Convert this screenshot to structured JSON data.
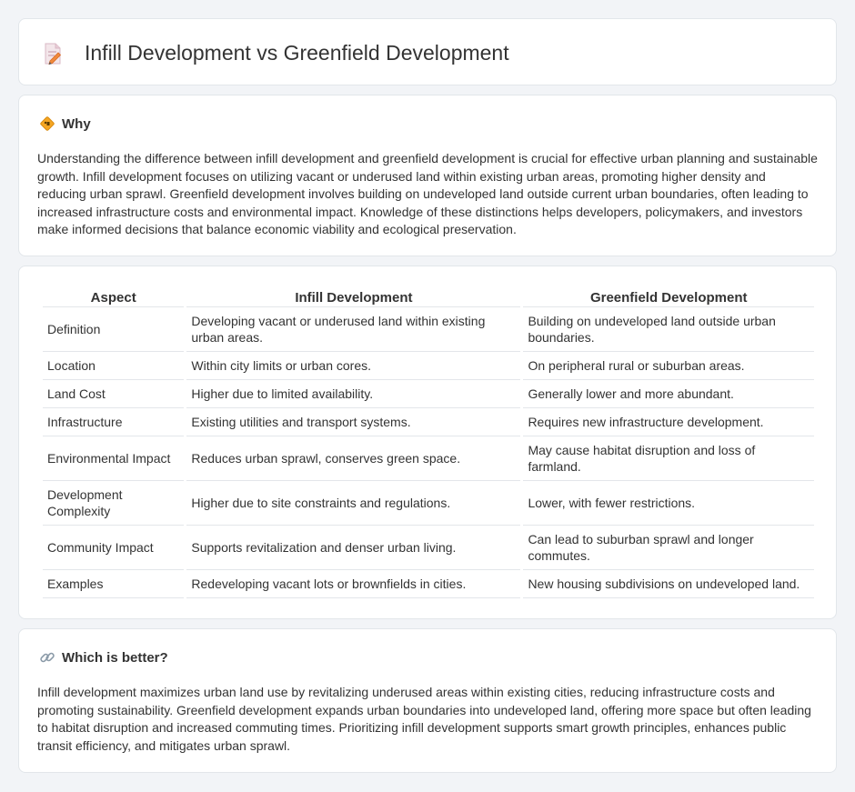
{
  "header": {
    "title": "Infill Development vs Greenfield Development",
    "icon": "document-pencil-icon"
  },
  "why": {
    "title": "Why",
    "icon": "diamond-sign-icon",
    "text": "Understanding the difference between infill development and greenfield development is crucial for effective urban planning and sustainable growth. Infill development focuses on utilizing vacant or underused land within existing urban areas, promoting higher density and reducing urban sprawl. Greenfield development involves building on undeveloped land outside current urban boundaries, often leading to increased infrastructure costs and environmental impact. Knowledge of these distinctions helps developers, policymakers, and investors make informed decisions that balance economic viability and ecological preservation."
  },
  "table": {
    "headers": [
      "Aspect",
      "Infill Development",
      "Greenfield Development"
    ],
    "rows": [
      [
        "Definition",
        "Developing vacant or underused land within existing urban areas.",
        "Building on undeveloped land outside urban boundaries."
      ],
      [
        "Location",
        "Within city limits or urban cores.",
        "On peripheral rural or suburban areas."
      ],
      [
        "Land Cost",
        "Higher due to limited availability.",
        "Generally lower and more abundant."
      ],
      [
        "Infrastructure",
        "Existing utilities and transport systems.",
        "Requires new infrastructure development."
      ],
      [
        "Environmental Impact",
        "Reduces urban sprawl, conserves green space.",
        "May cause habitat disruption and loss of farmland."
      ],
      [
        "Development Complexity",
        "Higher due to site constraints and regulations.",
        "Lower, with fewer restrictions."
      ],
      [
        "Community Impact",
        "Supports revitalization and denser urban living.",
        "Can lead to suburban sprawl and longer commutes."
      ],
      [
        "Examples",
        "Redeveloping vacant lots or brownfields in cities.",
        "New housing subdivisions on undeveloped land."
      ]
    ]
  },
  "better": {
    "title": "Which is better?",
    "icon": "link-icon",
    "text": "Infill development maximizes urban land use by revitalizing underused areas within existing cities, reducing infrastructure costs and promoting sustainability. Greenfield development expands urban boundaries into undeveloped land, offering more space but often leading to habitat disruption and increased commuting times. Prioritizing infill development supports smart growth principles, enhances public transit efficiency, and mitigates urban sprawl."
  }
}
